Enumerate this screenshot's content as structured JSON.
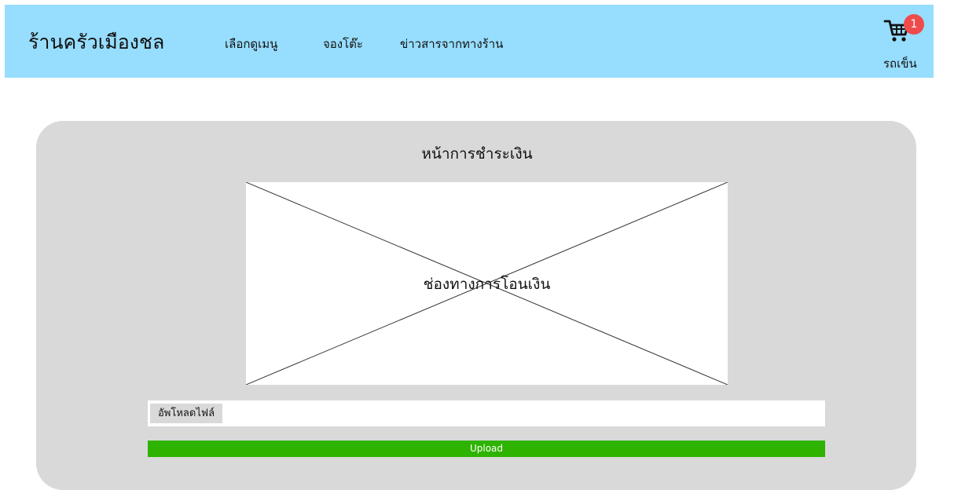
{
  "header": {
    "brand": "ร้านครัวเมืองชล",
    "nav": [
      {
        "label": "เลือกดูเมนู"
      },
      {
        "label": "จองโต๊ะ"
      },
      {
        "label": "ข่าวสารจากทางร้าน"
      }
    ],
    "cart": {
      "icon": "cart-icon",
      "badge": "1",
      "label": "รถเข็น"
    }
  },
  "main": {
    "title": "หน้าการชำระเงิน",
    "placeholder_label": "ช่องทางการโอนเงิน",
    "file_button_label": "อัพโหลดไฟล์",
    "upload_label": "Upload"
  },
  "colors": {
    "header_bg": "#97ddfd",
    "panel_bg": "#d9d9d9",
    "upload_bg": "#2db300",
    "badge_bg": "#f04b4b"
  }
}
